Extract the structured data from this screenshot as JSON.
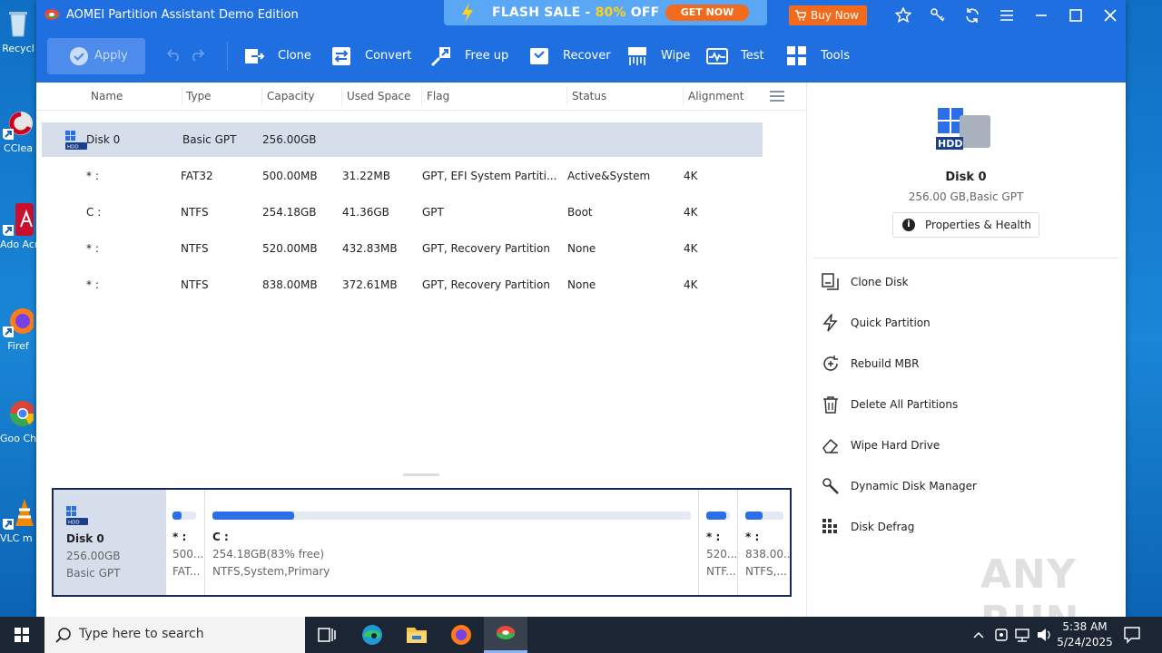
{
  "desktop": {
    "icons": [
      {
        "label": "Recycl",
        "color": "#7fb0d8"
      },
      {
        "label": "CClea",
        "color": "#e9e9e9"
      },
      {
        "label": "Ado Acro",
        "color": "#c8102e"
      },
      {
        "label": "Firef",
        "color": "#ff7a1a"
      },
      {
        "label": "Goo Chro",
        "color": "#34a853"
      },
      {
        "label": "VLC m play",
        "color": "#f08800"
      }
    ]
  },
  "window": {
    "title": "AOMEI Partition Assistant Demo Edition",
    "banner": {
      "sale_prefix": "FLASH SALE - ",
      "sale_pct": "80%",
      "sale_suffix": " OFF",
      "cta": "GET NOW"
    },
    "buy_now": "Buy Now"
  },
  "toolbar": {
    "apply": "Apply",
    "items": [
      {
        "label": "Clone",
        "icon": "clone-icon"
      },
      {
        "label": "Convert",
        "icon": "convert-icon"
      },
      {
        "label": "Free up",
        "icon": "free-up-icon"
      },
      {
        "label": "Recover",
        "icon": "recover-icon"
      },
      {
        "label": "Wipe",
        "icon": "wipe-icon"
      },
      {
        "label": "Test",
        "icon": "test-icon"
      },
      {
        "label": "Tools",
        "icon": "tools-icon"
      }
    ]
  },
  "table": {
    "columns": [
      "Name",
      "Type",
      "Capacity",
      "Used Space",
      "Flag",
      "Status",
      "Alignment"
    ],
    "rows": [
      {
        "name": "Disk 0",
        "type": "Basic GPT",
        "capacity": "256.00GB",
        "used": "",
        "flag": "",
        "status": "",
        "alignment": "",
        "selected": true
      },
      {
        "name": "* :",
        "type": "FAT32",
        "capacity": "500.00MB",
        "used": "31.22MB",
        "flag": "GPT, EFI System Partiti...",
        "status": "Active&System",
        "alignment": "4K"
      },
      {
        "name": "C :",
        "type": "NTFS",
        "capacity": "254.18GB",
        "used": "41.36GB",
        "flag": "GPT",
        "status": "Boot",
        "alignment": "4K"
      },
      {
        "name": "* :",
        "type": "NTFS",
        "capacity": "520.00MB",
        "used": "432.83MB",
        "flag": "GPT, Recovery Partition",
        "status": "None",
        "alignment": "4K"
      },
      {
        "name": "* :",
        "type": "NTFS",
        "capacity": "838.00MB",
        "used": "372.61MB",
        "flag": "GPT, Recovery Partition",
        "status": "None",
        "alignment": "4K"
      }
    ]
  },
  "diskmap": {
    "disk": {
      "name": "Disk 0",
      "size": "256.00GB",
      "type": "Basic GPT"
    },
    "partitions": [
      {
        "name": "* :",
        "line1": "500....",
        "line2": "FAT...",
        "used_fraction": 0.4
      },
      {
        "name": "C :",
        "line1": "254.18GB(83% free)",
        "line2": "NTFS,System,Primary",
        "used_fraction": 0.17
      },
      {
        "name": "* :",
        "line1": "520....",
        "line2": "NTF...",
        "used_fraction": 0.85
      },
      {
        "name": "* :",
        "line1": "838.00...",
        "line2": "NTFS,...",
        "used_fraction": 0.45
      }
    ]
  },
  "panel": {
    "disk_name": "Disk 0",
    "disk_sub": "256.00 GB,Basic GPT",
    "properties": "Properties & Health",
    "ops": [
      {
        "label": "Clone Disk",
        "icon": "clone-disk-icon"
      },
      {
        "label": "Quick Partition",
        "icon": "lightning-icon"
      },
      {
        "label": "Rebuild MBR",
        "icon": "rebuild-icon"
      },
      {
        "label": "Delete All Partitions",
        "icon": "trash-icon"
      },
      {
        "label": "Wipe Hard Drive",
        "icon": "eraser-icon"
      },
      {
        "label": "Dynamic Disk Manager",
        "icon": "wrench-icon"
      },
      {
        "label": "Disk Defrag",
        "icon": "defrag-icon"
      }
    ]
  },
  "taskbar": {
    "search_placeholder": "Type here to search",
    "time": "5:38 AM",
    "date": "5/24/2025"
  },
  "watermark": "ANY RUN",
  "colors": {
    "accent": "#1f6fe0",
    "selected_row": "#d6deeb",
    "bar_fill": "#2a6ee8",
    "sale_orange": "#f26a1b"
  }
}
